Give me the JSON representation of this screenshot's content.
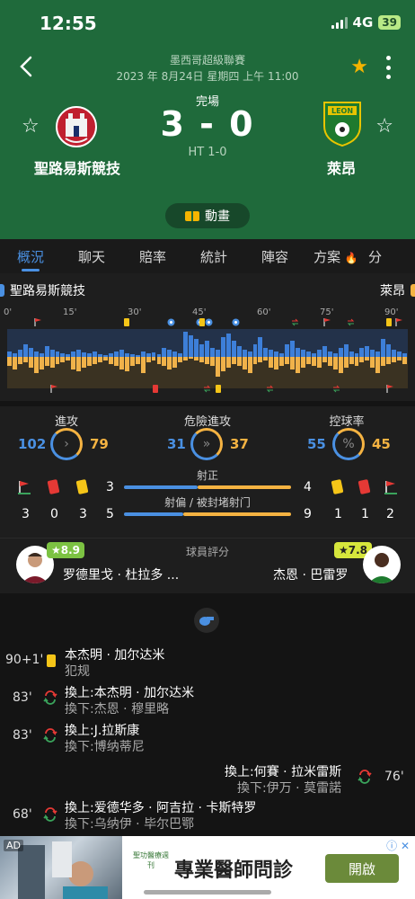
{
  "status_bar": {
    "time": "12:55",
    "network": "4G",
    "battery": "39"
  },
  "header": {
    "league": "墨西哥超級聯賽",
    "date": "2023 年 8月24日 星期四 上午 11:00",
    "status": "完場",
    "score": "3 - 0",
    "halftime": "HT 1-0",
    "home_team": "聖路易斯競技",
    "away_team": "萊昂",
    "animation_label": "動畫"
  },
  "colors": {
    "header_green": "#1f6a3b",
    "home_blue": "#4a90e2",
    "away_orange": "#f5b342",
    "star_gold": "#f4b400"
  },
  "tabs": [
    {
      "label": "概況",
      "active": true
    },
    {
      "label": "聊天",
      "active": false
    },
    {
      "label": "賠率",
      "active": false
    },
    {
      "label": "統計",
      "active": false
    },
    {
      "label": "陣容",
      "active": false
    },
    {
      "label": "方案",
      "active": false,
      "badge": "🔥"
    },
    {
      "label": "分",
      "active": false
    }
  ],
  "timeline": {
    "home_team": "聖路易斯競技",
    "away_team": "萊昂",
    "minute_ticks": [
      "0'",
      "15'",
      "30'",
      "45'",
      "60'",
      "75'",
      "90'"
    ]
  },
  "stats": {
    "attack": {
      "label": "進攻",
      "home": "102",
      "away": "79"
    },
    "dangerous": {
      "label": "危險進攻",
      "home": "31",
      "away": "37"
    },
    "possession": {
      "label": "控球率",
      "home": "55",
      "away": "45",
      "symbol": "%"
    },
    "on_target": {
      "label": "射正",
      "home": "3",
      "away": "4"
    },
    "off_target": {
      "label": "射偏 / 被封堵射门",
      "home": "5",
      "away": "9"
    },
    "home_counts": {
      "corners": "3",
      "red": "0",
      "yellow": "3"
    },
    "away_counts": {
      "yellow": "1",
      "red": "1",
      "corners": "2"
    }
  },
  "ratings": {
    "title": "球員評分",
    "home_player": {
      "name": "罗德里戈 · 杜拉多 ...",
      "rating": "★8.9"
    },
    "away_player": {
      "name": "杰恩 · 巴雷罗",
      "rating": "★7.8"
    }
  },
  "events": [
    {
      "minute": "90+1'",
      "line1": "本杰明 · 加尔达米",
      "line2": "犯规"
    },
    {
      "minute": "83'",
      "line1": "換上:本杰明 · 加尔达米",
      "line2": "換下:杰恩 · 穆里略"
    },
    {
      "minute": "83'",
      "line1": "換上:J.拉斯康",
      "line2": "換下:博纳蒂尼"
    },
    {
      "minute": "76'",
      "line1": "換上:何賽 · 拉米雷斯",
      "line2": "換下:伊万 · 莫雷諾"
    },
    {
      "minute": "68'",
      "line1": "換上:爱德华多 · 阿吉拉 · 卡斯特罗",
      "line2": "換下:乌纳伊 · 毕尔巴鄂"
    }
  ],
  "ad": {
    "label": "AD",
    "brand": "聖功醫療週刊",
    "title": "專業醫師問診",
    "button": "開啟"
  }
}
